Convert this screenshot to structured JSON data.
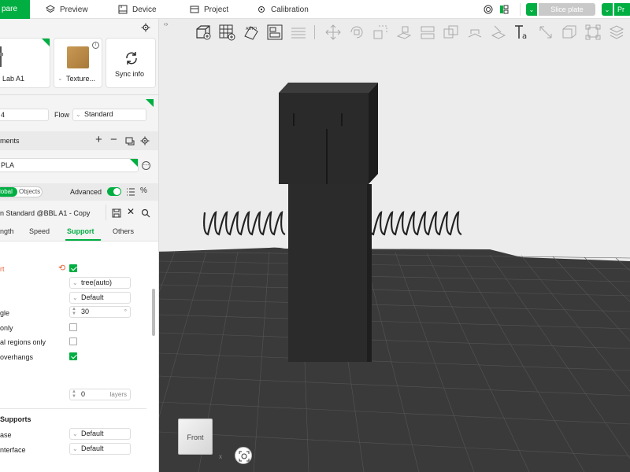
{
  "topbar": {
    "active_tab": "pare",
    "tabs": [
      "Preview",
      "Device",
      "Project",
      "Calibration"
    ],
    "slice_label": "Slice plate",
    "print_label": "Pr"
  },
  "printer": {
    "name": "Lab A1",
    "plate_label": "Texture...",
    "sync_label": "Sync info"
  },
  "flow": {
    "nozzle_value": "4",
    "flow_label": "Flow",
    "flow_value": "Standard"
  },
  "filaments": {
    "header": "ments",
    "item": "PLA"
  },
  "process": {
    "global_label": "lobal",
    "objects_label": "Objects",
    "advanced_label": "Advanced",
    "preset_name": "n Standard @BBL A1 - Copy"
  },
  "param_tabs": [
    "ngth",
    "Speed",
    "Support",
    "Others"
  ],
  "support": {
    "enable_label": "rt",
    "type_value": "tree(auto)",
    "style_value": "Default",
    "angle_label": "gle",
    "angle_value": "30",
    "angle_unit": "°",
    "buildplate_label": " only",
    "critical_label": "al regions only",
    "overhangs_label": " overhangs",
    "layers_value": "0",
    "layers_unit": "layers",
    "tree_header": "Supports",
    "base_label": "ase",
    "base_value": "Default",
    "interface_label": "nterface",
    "interface_value": "Default"
  },
  "viewport": {
    "cube_label": "Front"
  },
  "colors": {
    "accent": "#00ae42",
    "support_highlight": "#e8643c",
    "model": "#2b2b2b",
    "plate": "#3a3a3a"
  }
}
